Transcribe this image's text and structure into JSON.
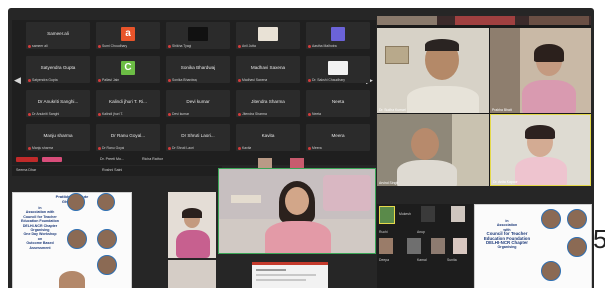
{
  "gallery": {
    "rows": [
      [
        {
          "name": "Sameer.ali",
          "label": "sameer ali",
          "kind": "name"
        },
        {
          "name": "",
          "label": "Sumi Choudhary",
          "kind": "square",
          "color": "#e8542a",
          "letter": "a"
        },
        {
          "name": "",
          "label": "Shikha Tyagi",
          "kind": "slide"
        },
        {
          "name": "",
          "label": "Anil Jutta",
          "kind": "photo"
        },
        {
          "name": "",
          "label": "Aastha Malhotra",
          "kind": "square",
          "color": "#6b63d8",
          "letter": ""
        }
      ],
      [
        {
          "name": "Satyendra Gupta",
          "label": "Satyendra Gupta",
          "kind": "name"
        },
        {
          "name": "",
          "label": "Pallavi Jain",
          "kind": "square",
          "color": "#6cbd45",
          "letter": "C"
        },
        {
          "name": "Sonika Bhardwaj",
          "label": "Sonika Bhardwaj",
          "kind": "name"
        },
        {
          "name": "Madhavi Saxena",
          "label": "Madhavi Saxena",
          "kind": "name"
        },
        {
          "name": "",
          "label": "Dr. Sakshi Chaudhary",
          "kind": "logo"
        }
      ],
      [
        {
          "name": "Dr Anukriti Sanghi...",
          "label": "Dr Anukriti Sanghi",
          "kind": "name"
        },
        {
          "name": "Kalindi jhuri T. Ri...",
          "label": "Kalindi jhuri T.",
          "kind": "name"
        },
        {
          "name": "Devi kumar",
          "label": "Devi kumar",
          "kind": "name"
        },
        {
          "name": "Jitendra Sharma",
          "label": "Jitendra Sharma",
          "kind": "name"
        },
        {
          "name": "Neeta",
          "label": "Neeta",
          "kind": "name"
        }
      ],
      [
        {
          "name": "Manju sharma",
          "label": "Manju sharma",
          "kind": "name"
        },
        {
          "name": "Dr Ranu Goyal...",
          "label": "Dr Ranu Goyal",
          "kind": "name"
        },
        {
          "name": "Dr Shruti Laori...",
          "label": "Dr Shruti Laori",
          "kind": "name"
        },
        {
          "name": "Kavita",
          "label": "Kavita",
          "kind": "name"
        },
        {
          "name": "Meera",
          "label": "Meera",
          "kind": "name"
        }
      ]
    ],
    "strip_labels": [
      "Dr. Preeti Mo...",
      "Richa Rathor"
    ],
    "footer_labels": [
      "Seema Dhar",
      "Roshni Saini"
    ]
  },
  "right_grid": {
    "labels": [
      "Dr. Sudha Kumari",
      "Prabha Bhatt",
      "Arvind Singh",
      "Dr. Anita Kapoor",
      "Anil Sharma",
      "Dr. Ritu Sharma"
    ]
  },
  "bottom": {
    "poster_left": {
      "title_lines": [
        "Pratibha Institute",
        "Ghaziabad"
      ],
      "lines": [
        "in",
        "Association with",
        "Council for Teacher",
        "Education Foundation",
        "DELHI-NCR Chapter",
        "Organising",
        "One Day Workshop",
        "on",
        "Outcome Based",
        "Assessment"
      ]
    },
    "poster_right": {
      "lines": [
        "in",
        "Association",
        "with",
        "Council for Teacher",
        "Education Foundation",
        "DELHI-NCR Chapter",
        "Organising"
      ]
    },
    "thumb_labels": [
      "Mukesh",
      "Ruchi",
      "Anup",
      "Deepa",
      "Kamal",
      "Sunita"
    ]
  },
  "edge_digit": "5",
  "colors": {
    "background": "#262626",
    "tile": "#2b2b2b",
    "poster_blue": "#1d3a7a",
    "mic_red": "#d23c3c"
  }
}
